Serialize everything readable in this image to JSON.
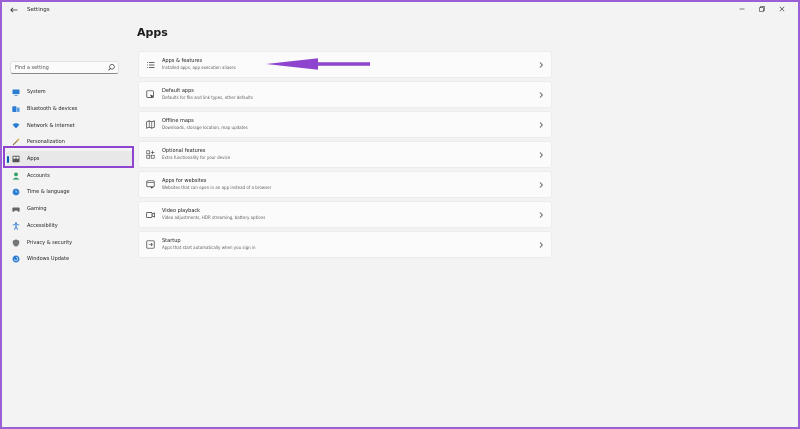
{
  "window": {
    "title": "Settings"
  },
  "search": {
    "placeholder": "Find a setting"
  },
  "sidebar": {
    "items": [
      {
        "label": "System",
        "icon": "monitor-icon",
        "color": "#2b7cd3"
      },
      {
        "label": "Bluetooth & devices",
        "icon": "bluetooth-icon",
        "color": "#2b7cd3"
      },
      {
        "label": "Network & internet",
        "icon": "wifi-icon",
        "color": "#2b7cd3"
      },
      {
        "label": "Personalization",
        "icon": "brush-icon",
        "color": "#8a6d3b"
      },
      {
        "label": "Apps",
        "icon": "apps-icon",
        "color": "#555555"
      },
      {
        "label": "Accounts",
        "icon": "person-icon",
        "color": "#2fa36b"
      },
      {
        "label": "Time & language",
        "icon": "globe-clock-icon",
        "color": "#2b7cd3"
      },
      {
        "label": "Gaming",
        "icon": "gamepad-icon",
        "color": "#666666"
      },
      {
        "label": "Accessibility",
        "icon": "accessibility-icon",
        "color": "#2b7cd3"
      },
      {
        "label": "Privacy & security",
        "icon": "shield-icon",
        "color": "#777777"
      },
      {
        "label": "Windows Update",
        "icon": "update-icon",
        "color": "#2b7cd3"
      }
    ]
  },
  "main": {
    "title": "Apps",
    "cards": [
      {
        "title": "Apps & features",
        "subtitle": "Installed apps, app execution aliases",
        "icon": "list-icon"
      },
      {
        "title": "Default apps",
        "subtitle": "Defaults for file and link types, other defaults",
        "icon": "default-apps-icon"
      },
      {
        "title": "Offline maps",
        "subtitle": "Downloads, storage location, map updates",
        "icon": "map-icon"
      },
      {
        "title": "Optional features",
        "subtitle": "Extra functionality for your device",
        "icon": "grid-plus-icon"
      },
      {
        "title": "Apps for websites",
        "subtitle": "Websites that can open in an app instead of a browser",
        "icon": "web-app-icon"
      },
      {
        "title": "Video playback",
        "subtitle": "Video adjustments, HDR streaming, battery options",
        "icon": "video-icon"
      },
      {
        "title": "Startup",
        "subtitle": "Apps that start automatically when you sign in",
        "icon": "startup-icon"
      }
    ]
  },
  "annotation": {
    "color": "#8e44ce"
  },
  "accent": "#005fb8"
}
